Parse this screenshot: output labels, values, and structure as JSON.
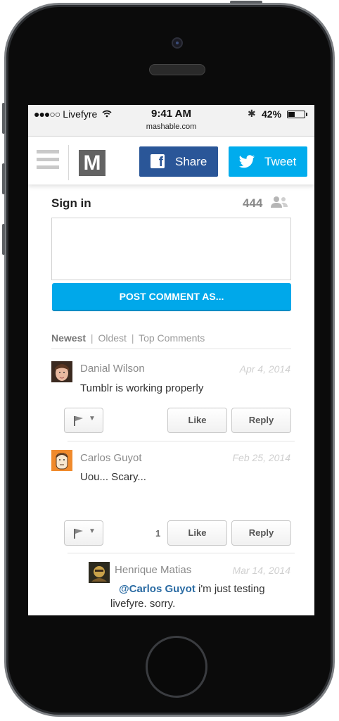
{
  "status_bar": {
    "signal": "●●●○○",
    "carrier": "Livefyre",
    "wifi_icon": "wifi-icon",
    "time": "9:41 AM",
    "url": "mashable.com",
    "bluetooth": "✱",
    "battery": "42%",
    "battery_level": 0.42
  },
  "header": {
    "logo": "M",
    "share_label": "Share",
    "tweet_label": "Tweet",
    "facebook_color": "#2a5698",
    "twitter_color": "#00aced"
  },
  "comments_widget": {
    "sign_in": "Sign in",
    "count": "444",
    "post_button": "POST COMMENT AS...",
    "accent_color": "#00a8ea",
    "sort": {
      "newest": "Newest",
      "oldest": "Oldest",
      "top": "Top Comments",
      "separator": "|"
    },
    "comments": [
      {
        "author": "Danial Wilson",
        "date": "Apr 4, 2014",
        "text": "Tumblr is working properly",
        "likes": "",
        "like_label": "Like",
        "reply_label": "Reply"
      },
      {
        "author": "Carlos Guyot",
        "date": "Feb 25, 2014",
        "text": "Uou... Scary...",
        "likes": "1",
        "like_label": "Like",
        "reply_label": "Reply"
      }
    ],
    "reply": {
      "author": "Henrique Matias",
      "date": "Mar 14, 2014",
      "mention": "@Carlos Guyot",
      "text": " i'm just testing livefyre. sorry."
    }
  }
}
